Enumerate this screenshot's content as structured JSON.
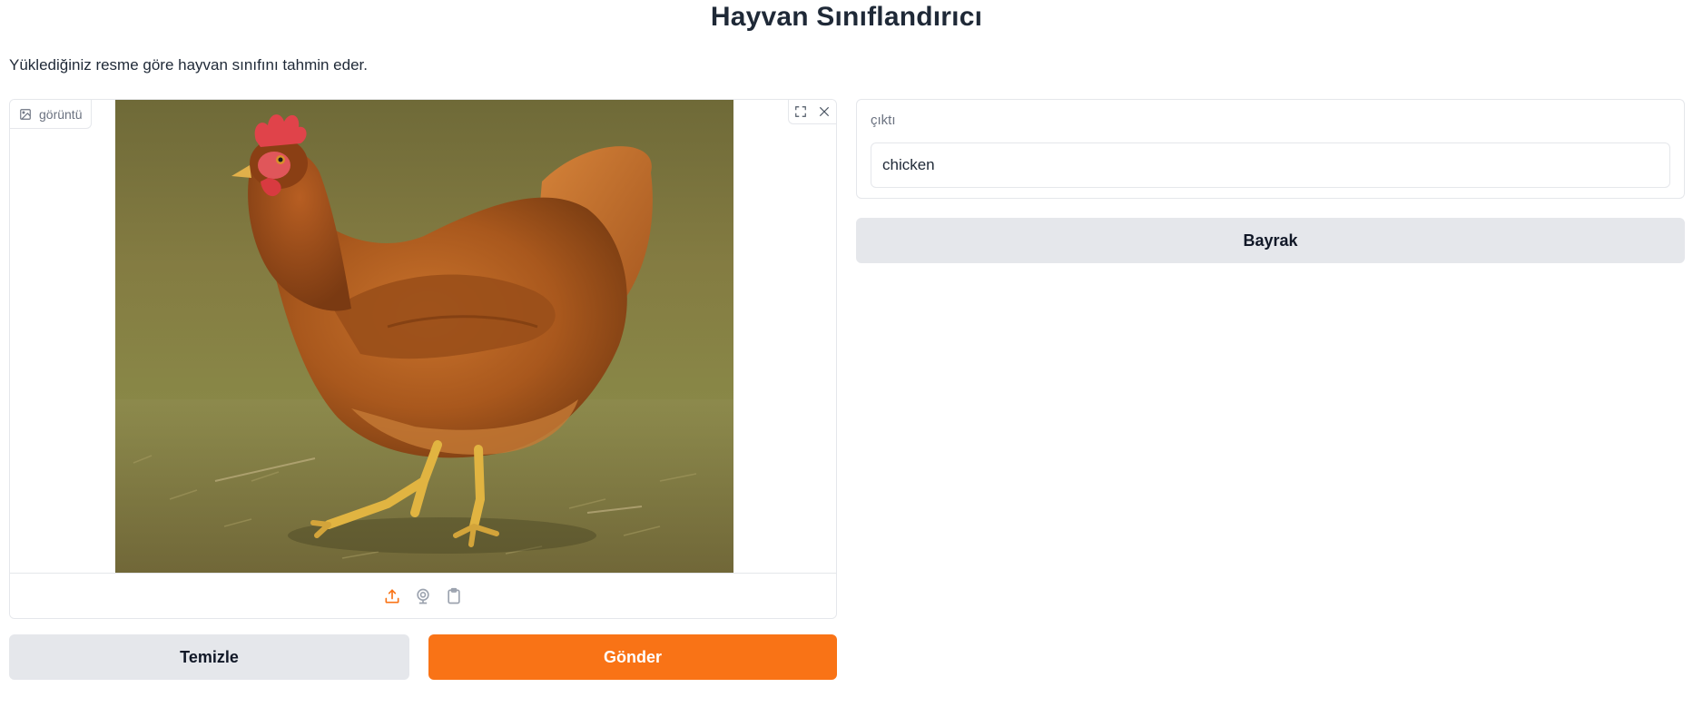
{
  "header": {
    "title": "Hayvan Sınıflandırıcı",
    "description": "Yüklediğiniz resme göre hayvan sınıfını tahmin eder."
  },
  "input_image": {
    "label": "görüntü",
    "label_icon": "image-icon",
    "corner_icons": [
      "fullscreen-icon",
      "close-icon"
    ],
    "source_icons": [
      "upload-icon",
      "webcam-icon",
      "clipboard-icon"
    ]
  },
  "actions": {
    "clear_label": "Temizle",
    "submit_label": "Gönder",
    "flag_label": "Bayrak"
  },
  "output": {
    "label": "çıktı",
    "value": "chicken"
  },
  "colors": {
    "primary": "#f97316",
    "secondary": "#e5e7eb",
    "border": "#e5e7eb",
    "text": "#1f2937",
    "muted": "#6b7280"
  }
}
